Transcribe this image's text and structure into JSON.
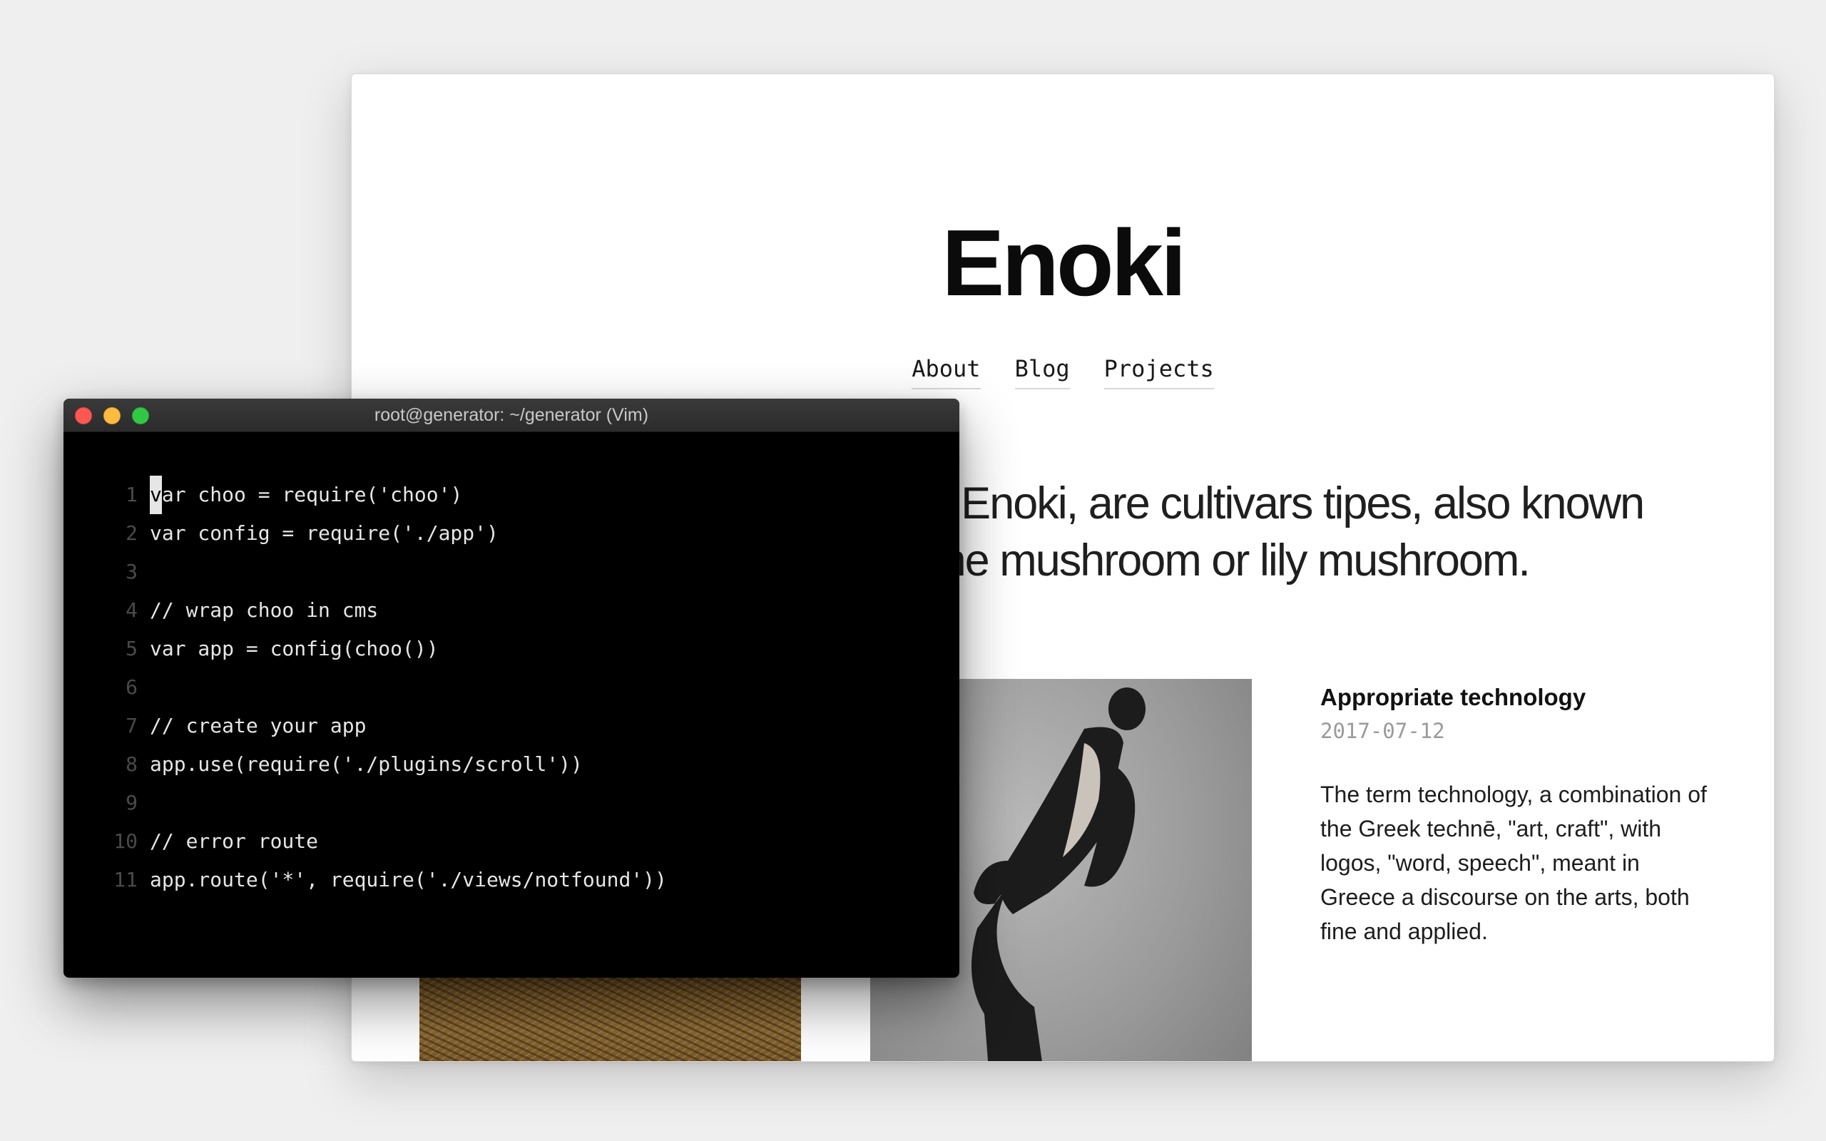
{
  "site": {
    "title": "Enoki",
    "nav": [
      "About",
      "Blog",
      "Projects"
    ],
    "intro": "okidake or Enoki, are cultivars tipes, also known by the name mushroom or lily mushroom.",
    "post": {
      "title": "Appropriate technology",
      "date": "2017-07-12",
      "body": "The term technology, a combination of the Greek technē, \"art, craft\", with logos, \"word, speech\", meant in Greece a discourse on the arts, both fine and applied."
    }
  },
  "terminal": {
    "title": "root@generator: ~/generator (Vim)",
    "cursor_char": "v",
    "lines": [
      {
        "num": "1",
        "text": "ar choo = require('choo')"
      },
      {
        "num": "2",
        "text": "var config = require('./app')"
      },
      {
        "num": "3",
        "text": ""
      },
      {
        "num": "4",
        "text": "// wrap choo in cms"
      },
      {
        "num": "5",
        "text": "var app = config(choo())"
      },
      {
        "num": "6",
        "text": ""
      },
      {
        "num": "7",
        "text": "// create your app"
      },
      {
        "num": "8",
        "text": "app.use(require('./plugins/scroll'))"
      },
      {
        "num": "9",
        "text": ""
      },
      {
        "num": "10",
        "text": "// error route"
      },
      {
        "num": "11",
        "text": "app.route('*', require('./views/notfound'))"
      }
    ]
  }
}
